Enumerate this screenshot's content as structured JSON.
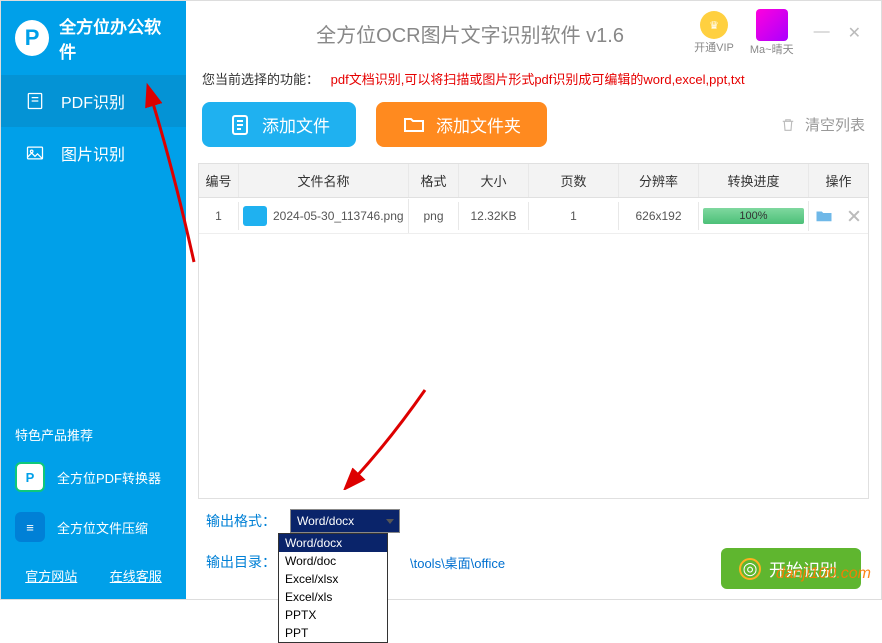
{
  "sidebar": {
    "logo_text": "全方位办公软件",
    "items": [
      {
        "label": "PDF识别",
        "active": true
      },
      {
        "label": "图片识别",
        "active": false
      }
    ],
    "promo_header": "特色产品推荐",
    "promos": [
      {
        "label": "全方位PDF转换器"
      },
      {
        "label": "全方位文件压缩"
      }
    ],
    "links": {
      "site": "官方网站",
      "support": "在线客服"
    }
  },
  "header": {
    "title": "全方位OCR图片文字识别软件 v1.6",
    "vip_label": "开通VIP",
    "user_name": "Ma~晴天"
  },
  "desc": {
    "label": "您当前选择的功能：",
    "text": "pdf文档识别,可以将扫描或图片形式pdf识别成可编辑的word,excel,ppt,txt"
  },
  "actions": {
    "add_file": "添加文件",
    "add_folder": "添加文件夹",
    "clear": "清空列表"
  },
  "table": {
    "headers": {
      "idx": "编号",
      "name": "文件名称",
      "fmt": "格式",
      "size": "大小",
      "pages": "页数",
      "res": "分辨率",
      "prog": "转换进度",
      "ops": "操作"
    },
    "rows": [
      {
        "idx": "1",
        "name": "2024-05-30_113746.png",
        "fmt": "png",
        "size": "12.32KB",
        "pages": "1",
        "res": "626x192",
        "prog": "100%"
      }
    ]
  },
  "output": {
    "format_label": "输出格式：",
    "format_value": "Word/docx",
    "format_options": [
      "Word/docx",
      "Word/doc",
      "Excel/xlsx",
      "Excel/xls",
      "PPTX",
      "PPT"
    ],
    "dir_label": "输出目录：",
    "dir_value": "\\tools\\桌面\\office"
  },
  "start_label": "开始识别",
  "watermark": "danji100.com"
}
